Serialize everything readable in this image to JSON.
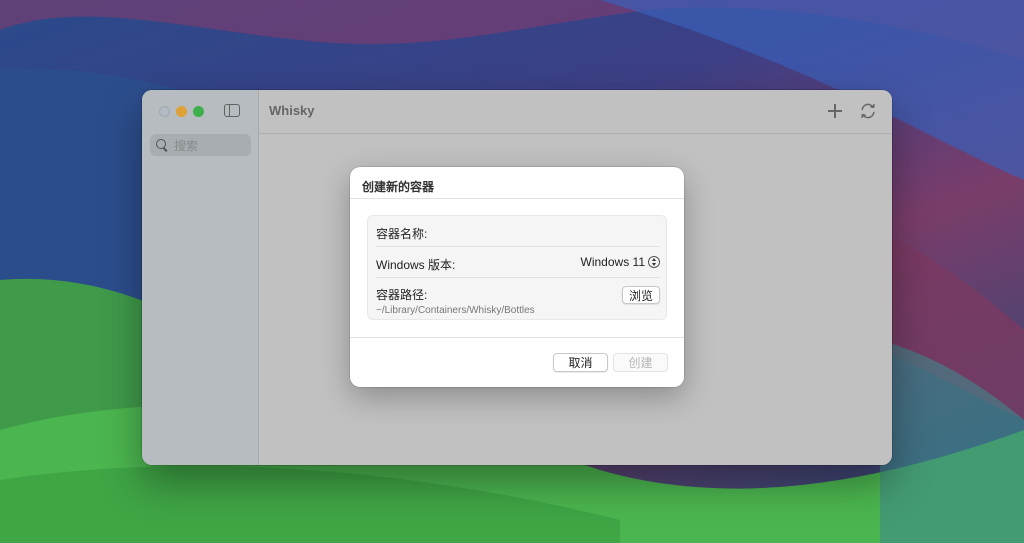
{
  "window": {
    "title": "Whisky"
  },
  "sidebar": {
    "search_placeholder": "搜索"
  },
  "dialog": {
    "title": "创建新的容器",
    "name_label": "容器名称:",
    "name_value": "",
    "version_label": "Windows 版本:",
    "version_value": "Windows 11",
    "path_label": "容器路径:",
    "path_value": "~/Library/Containers/Whisky/Bottles",
    "browse_label": "浏览",
    "cancel_label": "取消",
    "create_label": "创建"
  },
  "icons": {
    "add": "plus-icon",
    "refresh": "refresh-icon",
    "sidebar_toggle": "sidebar-toggle-icon",
    "search": "search-icon",
    "stepper": "stepper-icon"
  },
  "colors": {
    "close_dot": "#b9c0c9",
    "minimize_dot": "#e8a73b",
    "maximize_dot": "#3fb54e"
  }
}
